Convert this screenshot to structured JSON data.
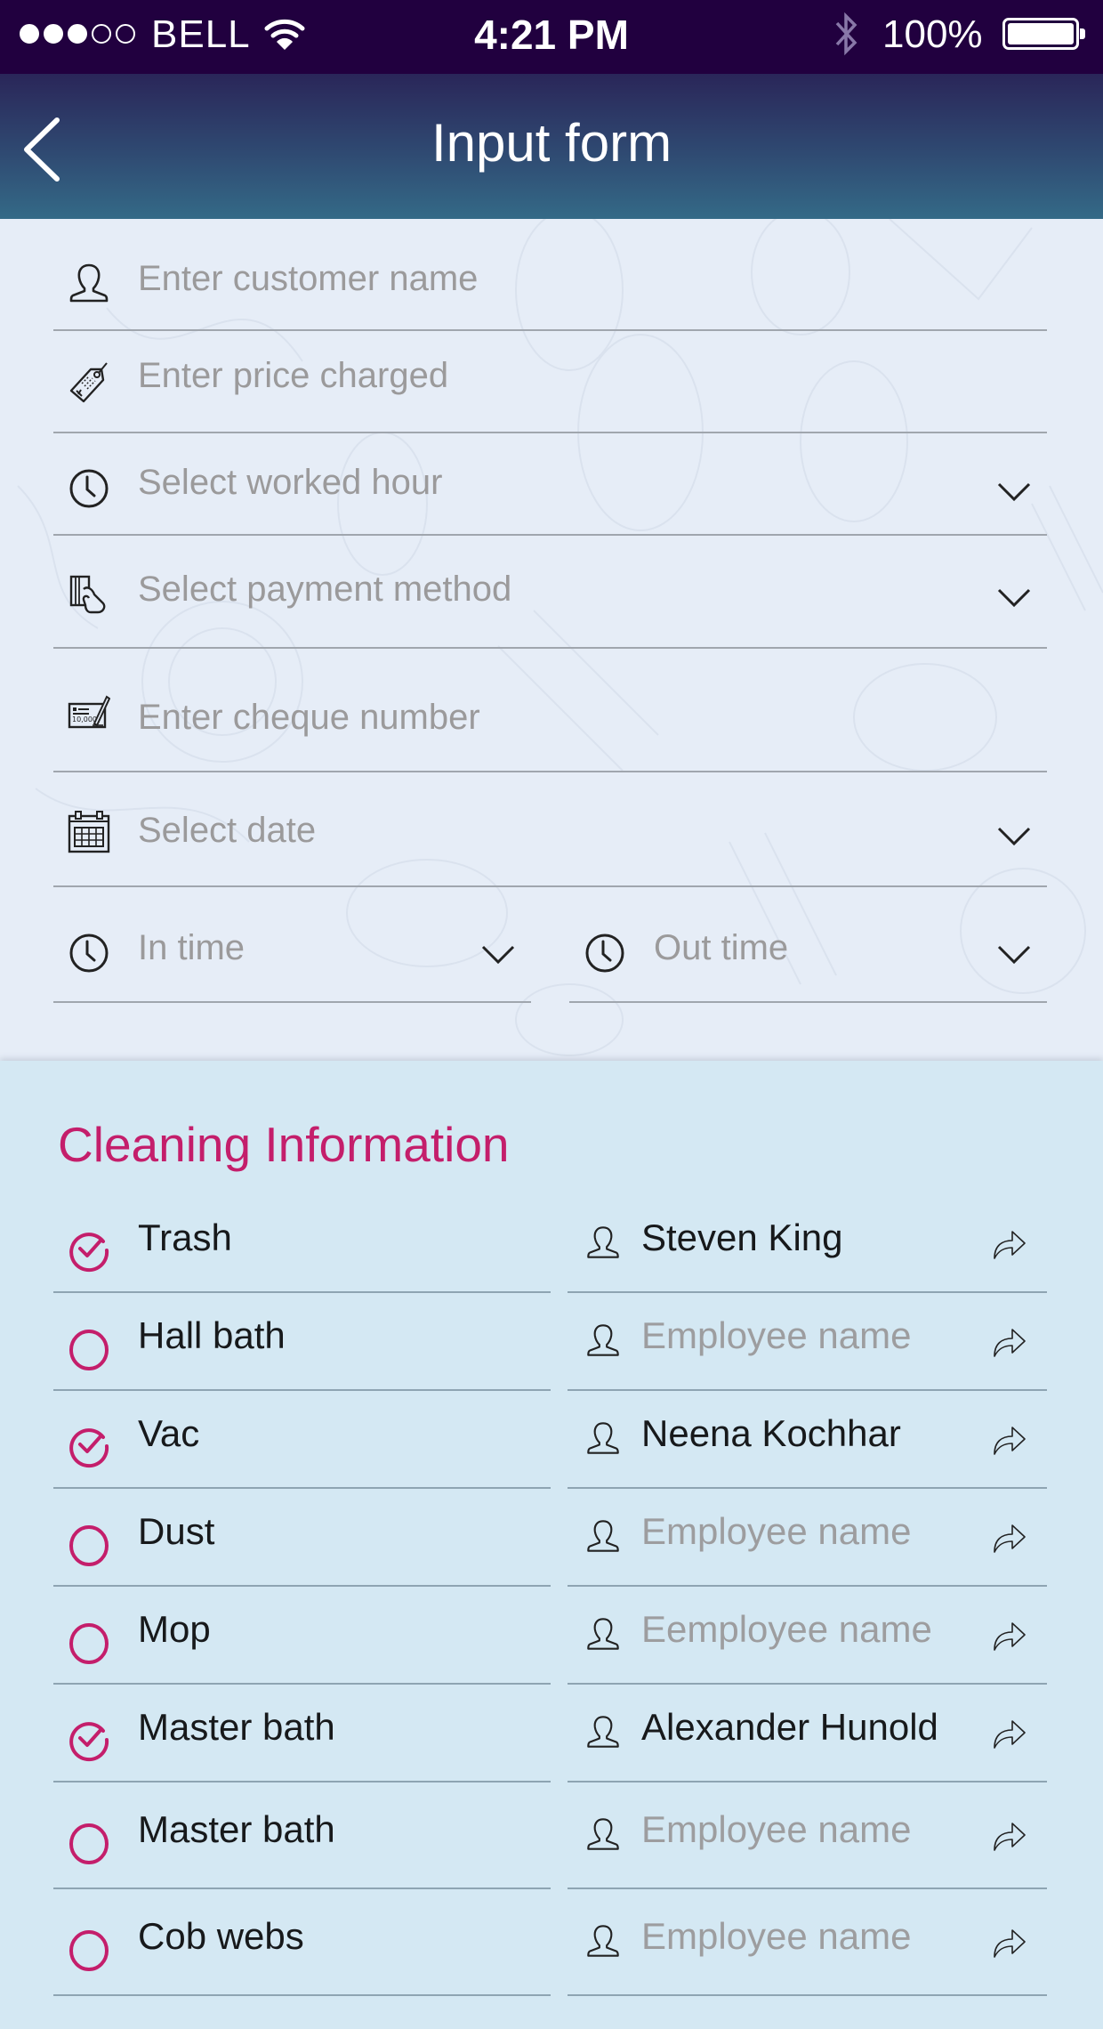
{
  "status_bar": {
    "signal_bars_filled": 3,
    "signal_bars_total": 5,
    "carrier": "BELL",
    "time": "4:21 PM",
    "battery_percent": "100%",
    "battery_level": 1.0,
    "icons": [
      "signal-dots-icon",
      "wifi-icon",
      "bluetooth-icon",
      "battery-icon"
    ]
  },
  "nav": {
    "title": "Input form",
    "back_icon": "chevron-left-icon"
  },
  "colors": {
    "status_bar_bg": "#21003f",
    "nav_gradient_top": "#2a2659",
    "nav_gradient_bottom": "#346a87",
    "form_bg": "#e6edf7",
    "section_bg": "#d4e8f3",
    "accent": "#c41e6b",
    "placeholder_text": "#9b9a9b",
    "body_text": "#17191b"
  },
  "form": {
    "fields": [
      {
        "id": "customer_name",
        "icon": "user-icon",
        "placeholder": "Enter customer name",
        "value": "",
        "type": "text"
      },
      {
        "id": "price_charged",
        "icon": "price-tag-icon",
        "placeholder": "Enter price charged",
        "value": "",
        "type": "text"
      },
      {
        "id": "worked_hour",
        "icon": "clock-icon",
        "placeholder": "Select worked hour",
        "value": "",
        "type": "select"
      },
      {
        "id": "payment_method",
        "icon": "card-payment-icon",
        "placeholder": "Select payment method",
        "value": "",
        "type": "select"
      },
      {
        "id": "cheque_number",
        "icon": "cheque-icon",
        "placeholder": "Enter cheque number",
        "value": "",
        "type": "text"
      },
      {
        "id": "date",
        "icon": "calendar-icon",
        "placeholder": "Select date",
        "value": "",
        "type": "select"
      },
      {
        "id": "in_time",
        "icon": "clock-icon",
        "placeholder": "In time",
        "value": "",
        "type": "select"
      },
      {
        "id": "out_time",
        "icon": "clock-icon",
        "placeholder": "Out time",
        "value": "",
        "type": "select"
      }
    ]
  },
  "cleaning": {
    "title": "Cleaning Information",
    "tasks": [
      {
        "task": "Trash",
        "checked": true,
        "employee": "Steven King",
        "employee_placeholder": "Employee name"
      },
      {
        "task": "Hall bath",
        "checked": false,
        "employee": "",
        "employee_placeholder": "Employee name"
      },
      {
        "task": "Vac",
        "checked": true,
        "employee": "Neena  Kochhar",
        "employee_placeholder": "Employee name"
      },
      {
        "task": "Dust",
        "checked": false,
        "employee": "",
        "employee_placeholder": "Employee name"
      },
      {
        "task": "Mop",
        "checked": false,
        "employee": "",
        "employee_placeholder": "Eemployee name"
      },
      {
        "task": "Master bath",
        "checked": true,
        "employee": "Alexander  Hunold",
        "employee_placeholder": "Employee name"
      },
      {
        "task": "Master bath",
        "checked": false,
        "employee": "",
        "employee_placeholder": "Employee name"
      },
      {
        "task": "Cob webs",
        "checked": false,
        "employee": "",
        "employee_placeholder": "Employee name"
      }
    ]
  }
}
